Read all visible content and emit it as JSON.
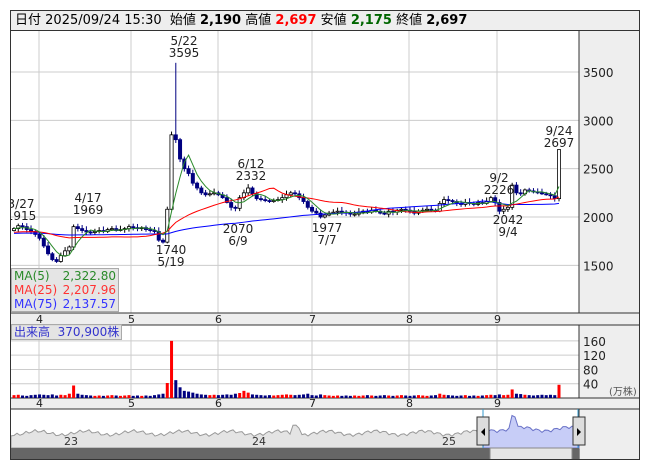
{
  "header": {
    "date_label": "日付",
    "date": "2025/09/24 15:30",
    "open_label": "始値",
    "open": "2,190",
    "high_label": "高値",
    "high": "2,697",
    "low_label": "安値",
    "low": "2,175",
    "close_label": "終値",
    "close": "2,697"
  },
  "colors": {
    "up_price": "#ff0000",
    "low_price": "#006600",
    "candle_down": "#000080",
    "vol_up": "#ff0000",
    "vol_down": "#000080",
    "ma5": "#2a8a2a",
    "ma25": "#ff0000",
    "ma75": "#0000ff"
  },
  "price_axis": {
    "ticks": [
      1500,
      2000,
      2500,
      3000,
      3500
    ]
  },
  "month_axis": [
    "4",
    "5",
    "6",
    "7",
    "8",
    "9"
  ],
  "annotations": [
    {
      "date": "3/27",
      "price": "1915"
    },
    {
      "date": "4/17",
      "price": "1969"
    },
    {
      "date": "5/22",
      "price": "3595"
    },
    {
      "date": "5/19",
      "price": "1740"
    },
    {
      "date": "6/12",
      "price": "2332"
    },
    {
      "date": "6/9",
      "price": "2070"
    },
    {
      "date": "7/7",
      "price": "1977"
    },
    {
      "date": "9/2",
      "price": "2226"
    },
    {
      "date": "9/4",
      "price": "2042"
    },
    {
      "date": "9/24",
      "price": "2697"
    }
  ],
  "legend": {
    "ma5": "MA(5)",
    "ma5_value": "2,322.80",
    "ma25": "MA(25)",
    "ma25_value": "2,207.96",
    "ma75": "MA(75)",
    "ma75_value": "2,137.57"
  },
  "volume": {
    "label": "出来高",
    "value": "370,900株",
    "ticks": [
      40,
      80,
      120,
      160
    ],
    "unit": "(万株)"
  },
  "navigator": {
    "years": [
      "23",
      "24",
      "25"
    ]
  },
  "closes": [
    1880,
    1910,
    1900,
    1870,
    1850,
    1820,
    1780,
    1700,
    1620,
    1560,
    1540,
    1600,
    1650,
    1690,
    1900,
    1880,
    1860,
    1845,
    1840,
    1850,
    1860,
    1850,
    1870,
    1880,
    1860,
    1870,
    1880,
    1900,
    1890,
    1880,
    1890,
    1870,
    1860,
    1850,
    1760,
    1740,
    2080,
    2850,
    2800,
    2600,
    2500,
    2450,
    2350,
    2300,
    2250,
    2230,
    2240,
    2250,
    2230,
    2200,
    2150,
    2100,
    2090,
    2200,
    2250,
    2300,
    2240,
    2190,
    2180,
    2170,
    2160,
    2170,
    2180,
    2200,
    2230,
    2250,
    2240,
    2200,
    2160,
    2100,
    2060,
    2040,
    2000,
    2020,
    2040,
    2050,
    2060,
    2050,
    2040,
    2030,
    2030,
    2050,
    2060,
    2050,
    2070,
    2060,
    2040,
    2030,
    2060,
    2050,
    2070,
    2080,
    2070,
    2060,
    2040,
    2060,
    2070,
    2080,
    2070,
    2060,
    2140,
    2180,
    2170,
    2160,
    2140,
    2130,
    2150,
    2140,
    2130,
    2150,
    2140,
    2160,
    2200,
    2150,
    2060,
    2080,
    2100,
    2330,
    2250,
    2240,
    2280,
    2270,
    2260,
    2250,
    2240,
    2230,
    2220,
    2190,
    2697
  ],
  "volumes": [
    8,
    9,
    7,
    6,
    8,
    9,
    10,
    9,
    8,
    10,
    7,
    9,
    8,
    12,
    35,
    12,
    9,
    8,
    7,
    6,
    7,
    6,
    7,
    8,
    7,
    6,
    7,
    8,
    6,
    7,
    6,
    7,
    6,
    8,
    10,
    12,
    42,
    160,
    50,
    30,
    20,
    18,
    15,
    12,
    10,
    9,
    8,
    9,
    8,
    9,
    10,
    9,
    12,
    14,
    20,
    15,
    10,
    9,
    8,
    7,
    8,
    7,
    8,
    9,
    10,
    9,
    8,
    9,
    10,
    12,
    8,
    7,
    10,
    8,
    7,
    6,
    7,
    6,
    7,
    6,
    7,
    6,
    7,
    8,
    7,
    6,
    7,
    8,
    7,
    6,
    7,
    8,
    7,
    6,
    7,
    8,
    7,
    6,
    7,
    8,
    12,
    9,
    8,
    7,
    6,
    7,
    8,
    6,
    7,
    6,
    7,
    8,
    9,
    8,
    10,
    8,
    9,
    24,
    12,
    11,
    9,
    8,
    7,
    8,
    9,
    8,
    9,
    8,
    37
  ]
}
